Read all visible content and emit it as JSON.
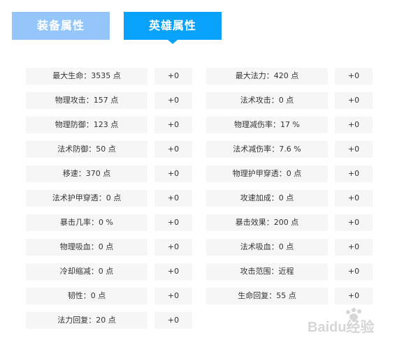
{
  "tabs": [
    {
      "label": "装备属性",
      "active": false
    },
    {
      "label": "英雄属性",
      "active": true
    }
  ],
  "colors": {
    "tab_inactive": "#94c6fb",
    "tab_active": "#08a2fa",
    "cell_bg": "#f6f6f6",
    "text": "#333333"
  },
  "attributes": [
    {
      "left": {
        "label": "最大生命：3535 点",
        "value": "+0"
      },
      "right": {
        "label": "最大法力：420 点",
        "value": "+0"
      }
    },
    {
      "left": {
        "label": "物理攻击：157 点",
        "value": "+0"
      },
      "right": {
        "label": "法术攻击：0 点",
        "value": "+0"
      }
    },
    {
      "left": {
        "label": "物理防御：123 点",
        "value": "+0"
      },
      "right": {
        "label": "物理减伤率：17 %",
        "value": "+0"
      }
    },
    {
      "left": {
        "label": "法术防御：50 点",
        "value": "+0"
      },
      "right": {
        "label": "法术减伤率：7.6 %",
        "value": "+0"
      }
    },
    {
      "left": {
        "label": "移速：370 点",
        "value": "+0"
      },
      "right": {
        "label": "物理护甲穿透：0 点",
        "value": "+0"
      }
    },
    {
      "left": {
        "label": "法术护甲穿透：0 点",
        "value": "+0"
      },
      "right": {
        "label": "攻速加成：0 点",
        "value": "+0"
      }
    },
    {
      "left": {
        "label": "暴击几率：0 %",
        "value": "+0"
      },
      "right": {
        "label": "暴击效果：200 点",
        "value": "+0"
      }
    },
    {
      "left": {
        "label": "物理吸血：0 点",
        "value": "+0"
      },
      "right": {
        "label": "法术吸血：0 点",
        "value": "+0"
      }
    },
    {
      "left": {
        "label": "冷却缩减：0 点",
        "value": "+0"
      },
      "right": {
        "label": "攻击范围：近程",
        "value": "+0"
      }
    },
    {
      "left": {
        "label": "韧性：0 点",
        "value": "+0"
      },
      "right": {
        "label": "生命回复：55 点",
        "value": "+0"
      }
    },
    {
      "left": {
        "label": "法力回复：20 点",
        "value": "+0"
      }
    }
  ],
  "watermark": {
    "text": "Baidu经验",
    "icon": "baidu-paw-icon"
  }
}
